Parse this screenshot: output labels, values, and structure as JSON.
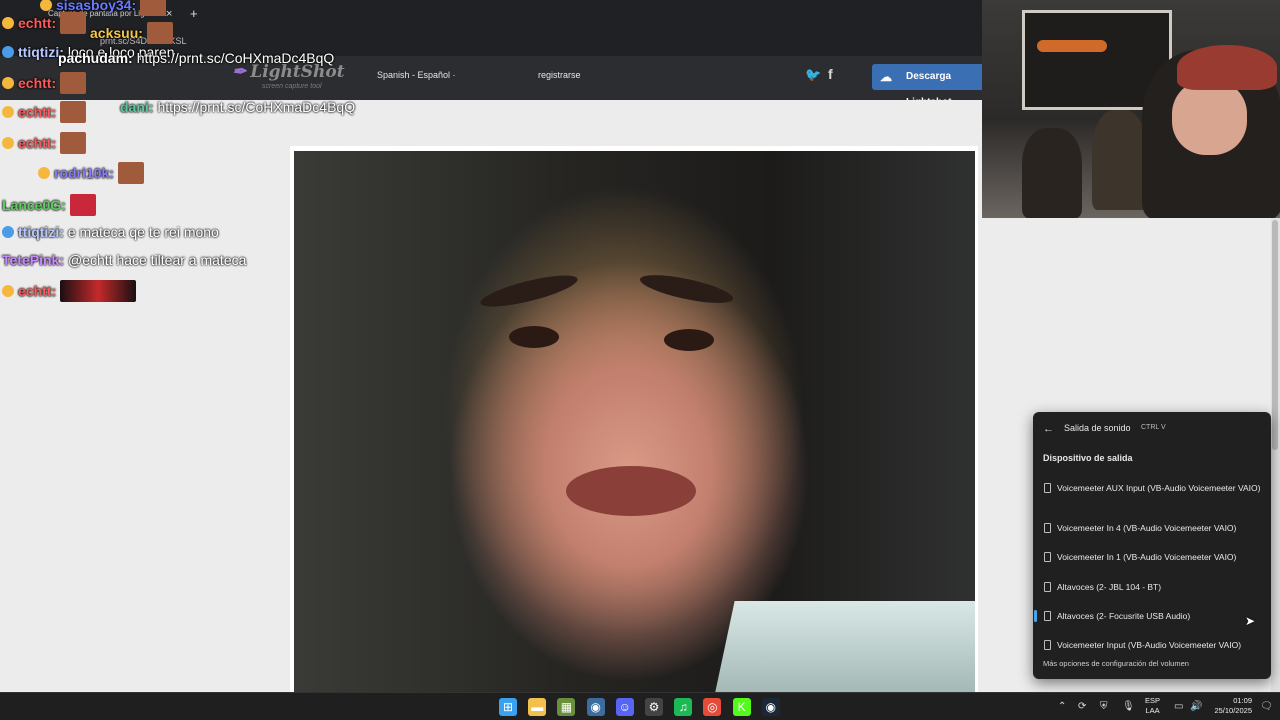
{
  "browser": {
    "tab_title": "Captura de pantalla por Lightshot",
    "close_glyph": "×",
    "new_tab_glyph": "+",
    "url": "prnt.sc/S4D...7LdKSL"
  },
  "lightshot": {
    "logo": "LightShot",
    "tagline": "screen capture tool",
    "language": "Spanish - Español ·",
    "register": "registrarse",
    "twitter_icon": "twitter-icon",
    "facebook_icon": "facebook-icon",
    "download_label": "Descarga Lightshot"
  },
  "chat": [
    {
      "user": "sisasboy34:",
      "user_color": "#6b7bff",
      "text": "",
      "badge": "#f5b83d"
    },
    {
      "user": "echtt:",
      "user_color": "#ff5a5a",
      "text": "",
      "badge": "#f5b83d"
    },
    {
      "user": "acksuu:",
      "user_color": "#f5c74a",
      "text": "",
      "badge": ""
    },
    {
      "user": "ttiqtizi:",
      "user_color": "#b9c9ff",
      "text": "loco e loco paren",
      "badge": "#4a9be8"
    },
    {
      "user": "pachudam:",
      "user_color": "#ffffff",
      "text": "https://prnt.sc/CoHXmaDc4BqQ",
      "badge": ""
    },
    {
      "user": "echtt:",
      "user_color": "#ff5a5a",
      "text": "",
      "badge": "#f5b83d"
    },
    {
      "user": "echtt:",
      "user_color": "#ff5a5a",
      "text": "",
      "badge": "#f5b83d"
    },
    {
      "user": "dani:",
      "user_color": "#5ac8a0",
      "text": "https://prnt.sc/CoHXmaDc4BqQ",
      "badge": ""
    },
    {
      "user": "echtt:",
      "user_color": "#ff5a5a",
      "text": "",
      "badge": "#f5b83d"
    },
    {
      "user": "rodri10k:",
      "user_color": "#8a7bff",
      "text": "",
      "badge": "#f5b83d"
    },
    {
      "user": "Lance0G:",
      "user_color": "#5ad15a",
      "text": "",
      "badge": ""
    },
    {
      "user": "ttiqtizi:",
      "user_color": "#b9c9ff",
      "text": "e mateca qe te rei mono",
      "badge": "#4a9be8"
    },
    {
      "user": "TetePink:",
      "user_color": "#c88aff",
      "text": "@echtt hace tiltear a mateca",
      "badge": ""
    },
    {
      "user": "echtt:",
      "user_color": "#ff5a5a",
      "text": "",
      "badge": "#f5b83d"
    }
  ],
  "sound_panel": {
    "back_icon": "back-arrow-icon",
    "title": "Salida de sonido",
    "shortcut": "CTRL   V",
    "section": "Dispositivo de salida",
    "devices": [
      {
        "label": "Voicemeeter AUX Input (VB-Audio Voicemeeter VAIO)",
        "selected": false
      },
      {
        "label": "Voicemeeter In 4 (VB-Audio Voicemeeter VAIO)",
        "selected": false
      },
      {
        "label": "Voicemeeter In 1 (VB-Audio Voicemeeter VAIO)",
        "selected": false
      },
      {
        "label": "Altavoces (2- JBL 104 - BT)",
        "selected": false
      },
      {
        "label": "Altavoces (2- Focusrite USB Audio)",
        "selected": true
      },
      {
        "label": "Voicemeeter Input (VB-Audio Voicemeeter VAIO)",
        "selected": false
      }
    ],
    "more": "Más opciones de configuración del volumen"
  },
  "taskbar": {
    "apps": [
      {
        "name": "windows-start-icon",
        "color": "#3aa0f0",
        "glyph": "⊞"
      },
      {
        "name": "file-explorer-icon",
        "color": "#f2c14b",
        "glyph": "▬"
      },
      {
        "name": "spreadsheet-app-icon",
        "color": "#6b8e3a",
        "glyph": "▦"
      },
      {
        "name": "steam-icon",
        "color": "#3b6e9e",
        "glyph": "◉"
      },
      {
        "name": "discord-icon",
        "color": "#5865f2",
        "glyph": "☺"
      },
      {
        "name": "settings-app-icon",
        "color": "#444444",
        "glyph": "⚙"
      },
      {
        "name": "spotify-icon",
        "color": "#1db954",
        "glyph": "♫"
      },
      {
        "name": "chrome-icon",
        "color": "#e44b3a",
        "glyph": "◎"
      },
      {
        "name": "kick-icon",
        "color": "#53fc18",
        "glyph": "K"
      },
      {
        "name": "steam-icon-2",
        "color": "#1b2838",
        "glyph": "◉"
      }
    ],
    "lang_top": "ESP",
    "lang_bottom": "LAA",
    "time": "01:09",
    "date": "25/10/2025"
  }
}
